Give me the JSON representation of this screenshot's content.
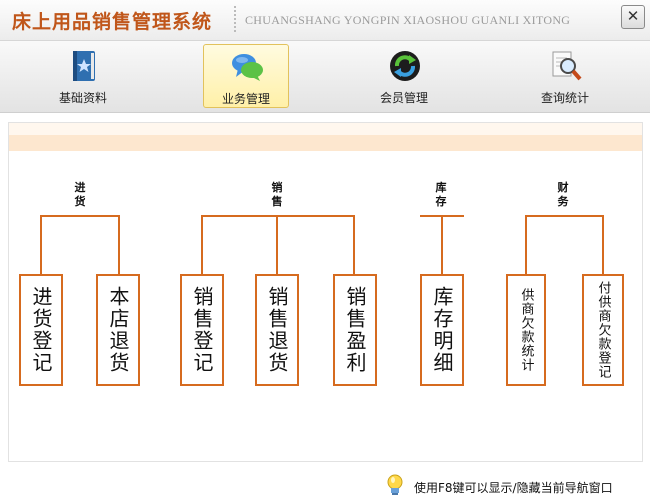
{
  "window": {
    "title": "床上用品销售管理系统",
    "subtitle": "CHUANGSHANG YONGPIN XIAOSHOU GUANLI XITONG",
    "close_glyph": "✕"
  },
  "toolbar": {
    "items": [
      {
        "label": "基础资料",
        "icon": "book-icon",
        "active": false
      },
      {
        "label": "业务管理",
        "icon": "chat-bubbles-icon",
        "active": true
      },
      {
        "label": "会员管理",
        "icon": "sync-arrows-icon",
        "active": false
      },
      {
        "label": "查询统计",
        "icon": "magnifier-icon",
        "active": false
      }
    ]
  },
  "diagram": {
    "groups": [
      {
        "label": "进货",
        "items": [
          "进货登记",
          "本店退货"
        ]
      },
      {
        "label": "销售",
        "items": [
          "销售登记",
          "销售退货",
          "销售盈利"
        ]
      },
      {
        "label": "库存",
        "items": [
          "库存明细"
        ]
      },
      {
        "label": "财务",
        "items": [
          "供商欠款统计",
          "付供商欠款登记"
        ]
      }
    ],
    "accent_color": "#d66b1f"
  },
  "footer": {
    "hint": "使用F8键可以显示/隐藏当前导航窗口",
    "icon": "lightbulb-icon"
  }
}
